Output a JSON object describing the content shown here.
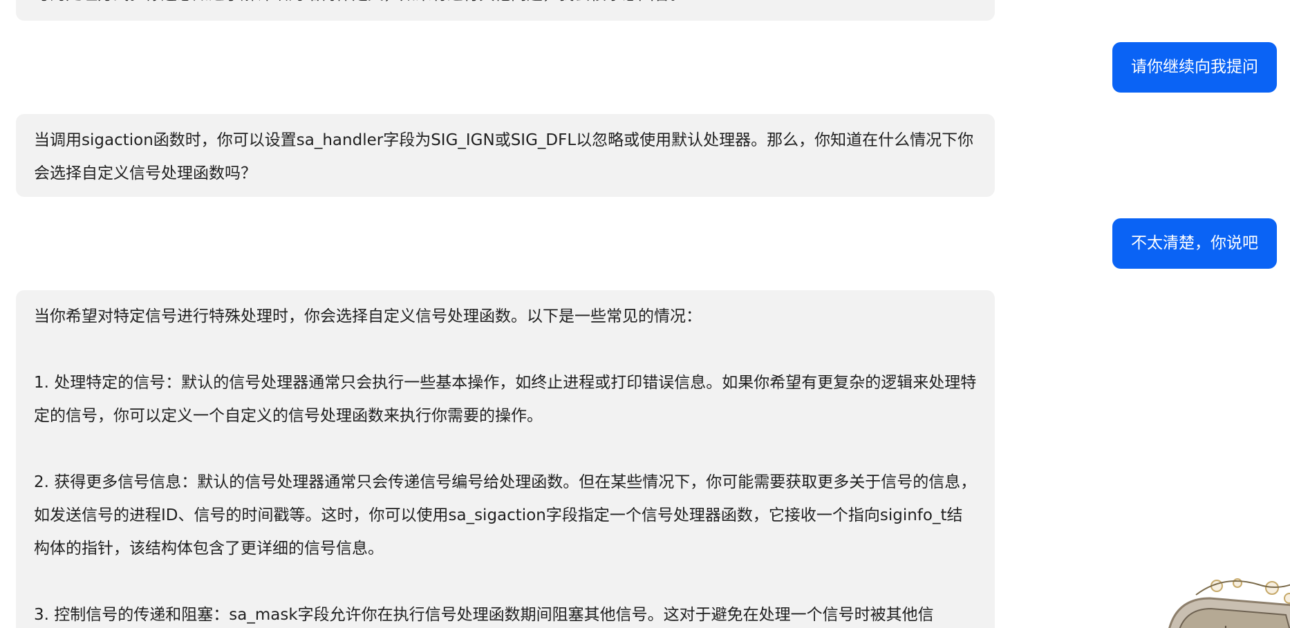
{
  "messages": [
    {
      "role": "assistant",
      "text": "与的处理方式。你还想知道了解详细的结构体定义，如果有进行其他问题，我会很乐意回答。"
    },
    {
      "role": "user",
      "text": "请你继续向我提问"
    },
    {
      "role": "assistant",
      "text": "当调用sigaction函数时，你可以设置sa_handler字段为SIG_IGN或SIG_DFL以忽略或使用默认处理器。那么，你知道在什么情况下你会选择自定义信号处理函数吗？"
    },
    {
      "role": "user",
      "text": "不太清楚，你说吧"
    },
    {
      "role": "assistant",
      "paragraphs": [
        "当你希望对特定信号进行特殊处理时，你会选择自定义信号处理函数。以下是一些常见的情况：",
        "1. 处理特定的信号：默认的信号处理器通常只会执行一些基本操作，如终止进程或打印错误信息。如果你希望有更复杂的逻辑来处理特定的信号，你可以定义一个自定义的信号处理函数来执行你需要的操作。",
        "2. 获得更多信号信息：默认的信号处理器通常只会传递信号编号给处理函数。但在某些情况下，你可能需要获取更多关于信号的信息，如发送信号的进程ID、信号的时间戳等。这时，你可以使用sa_sigaction字段指定一个信号处理器函数，它接收一个指向siginfo_t结构体的指针，该结构体包含了更详细的信号信息。",
        "3. 控制信号的传递和阻塞：sa_mask字段允许你在执行信号处理函数期间阻塞其他信号。这对于避免在处理一个信号时被其他信"
      ]
    }
  ],
  "colors": {
    "user_bubble": "#0a63f5",
    "assistant_bubble": "#f2f2f2"
  },
  "decoration": "floral-seal-ornament"
}
